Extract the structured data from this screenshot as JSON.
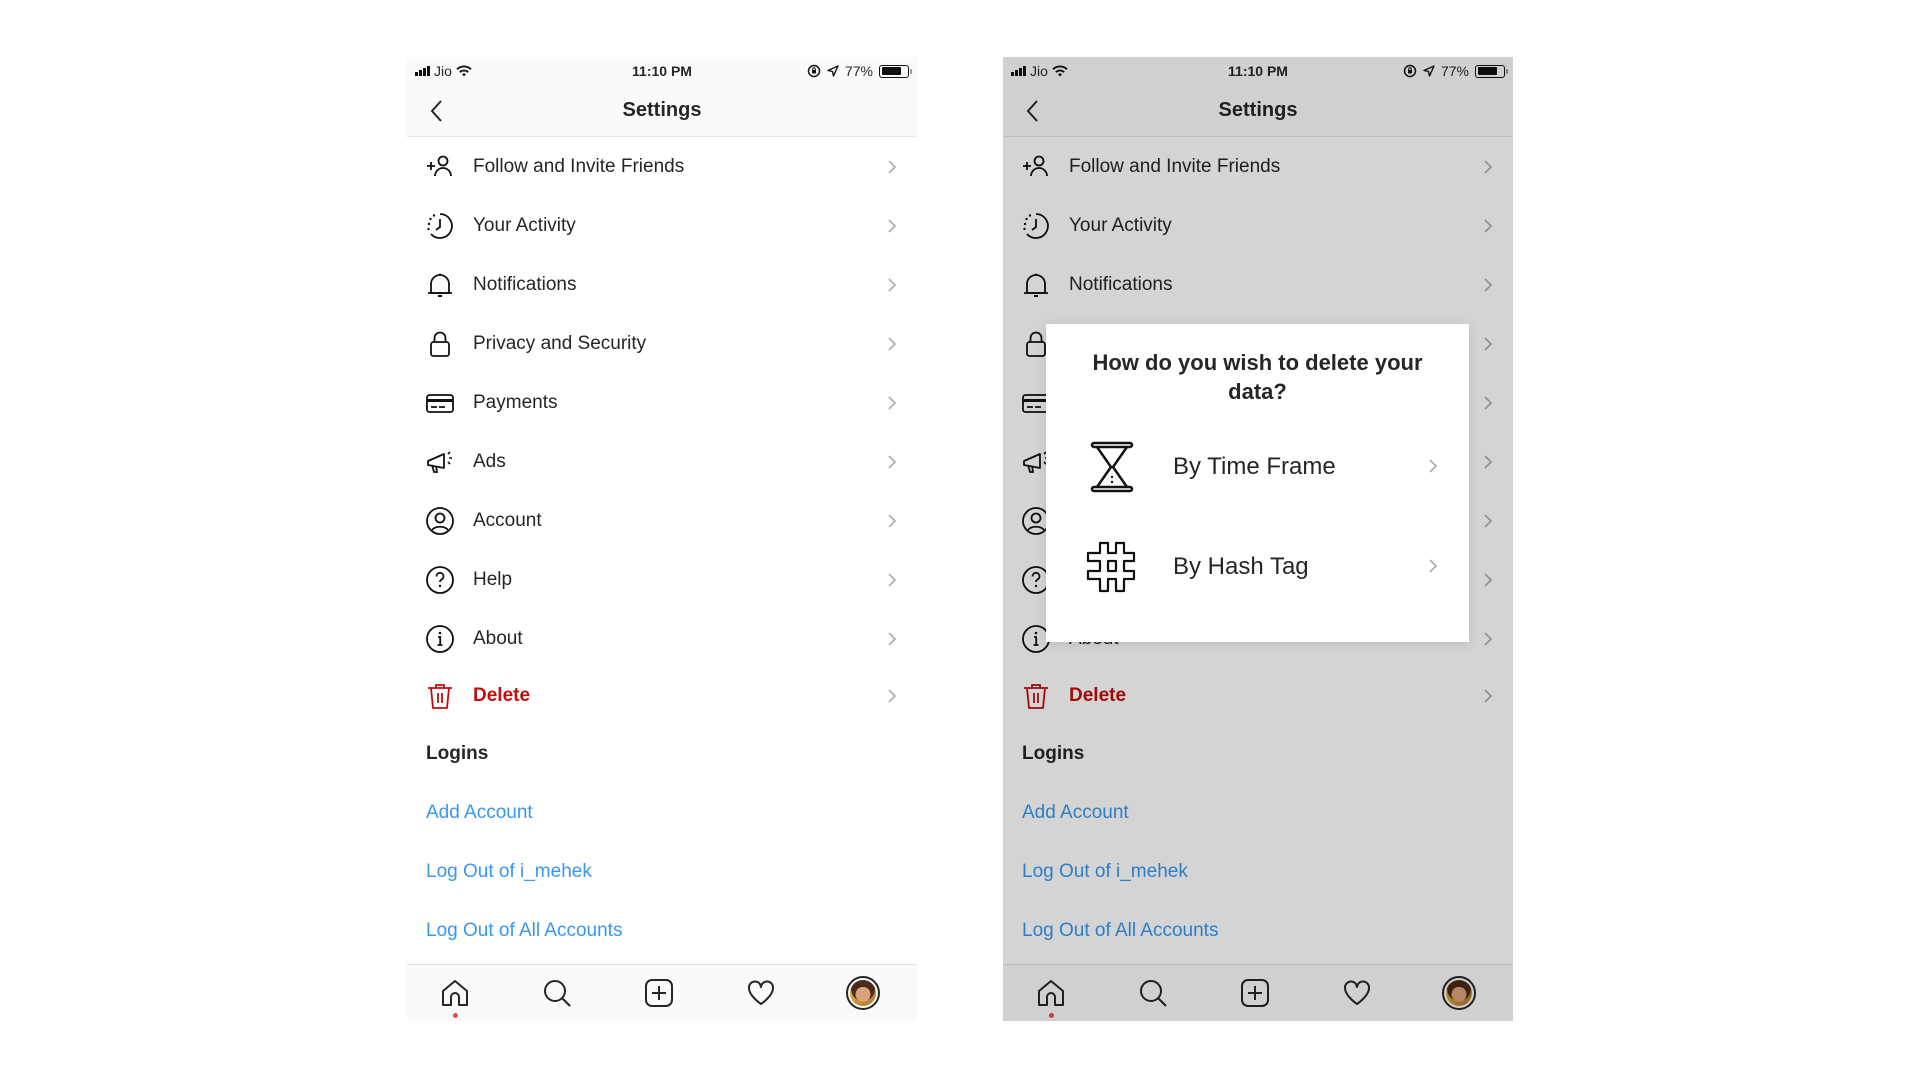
{
  "colors": {
    "danger": "#c20d0d",
    "link": "#3897f0",
    "notification_dot": "#ed4956",
    "overlay": "rgba(0,0,0,0.17)"
  },
  "status_bar": {
    "carrier": "Jio",
    "time": "11:10 PM",
    "battery": "77%",
    "battery_level": 0.77,
    "icons": [
      "signal-icon",
      "wifi-icon",
      "orientation-lock-icon",
      "location-icon",
      "battery-icon"
    ]
  },
  "header": {
    "title": "Settings",
    "back_icon": "chevron-left-icon"
  },
  "menu": [
    {
      "label": "Follow and Invite Friends",
      "icon": "add-person-icon"
    },
    {
      "label": "Your Activity",
      "icon": "activity-clock-icon"
    },
    {
      "label": "Notifications",
      "icon": "bell-icon"
    },
    {
      "label": "Privacy and Security",
      "icon": "lock-icon"
    },
    {
      "label": "Payments",
      "icon": "credit-card-icon"
    },
    {
      "label": "Ads",
      "icon": "megaphone-icon"
    },
    {
      "label": "Account",
      "icon": "account-circle-icon"
    },
    {
      "label": "Help",
      "icon": "help-circle-icon"
    },
    {
      "label": "About",
      "icon": "info-circle-icon"
    },
    {
      "label": "Delete",
      "icon": "trash-icon",
      "danger": true
    }
  ],
  "logins": {
    "heading": "Logins",
    "links": [
      "Add Account",
      "Log Out of i_mehek",
      "Log Out of All Accounts"
    ]
  },
  "tabbar": {
    "tabs": [
      "home-icon",
      "search-icon",
      "new-post-icon",
      "activity-heart-icon",
      "profile-avatar"
    ],
    "active": "home-icon"
  },
  "modal": {
    "question": "How do you wish to delete your data?",
    "options": [
      {
        "label": "By Time Frame",
        "icon": "hourglass-icon"
      },
      {
        "label": "By Hash Tag",
        "icon": "hashtag-icon"
      }
    ]
  }
}
